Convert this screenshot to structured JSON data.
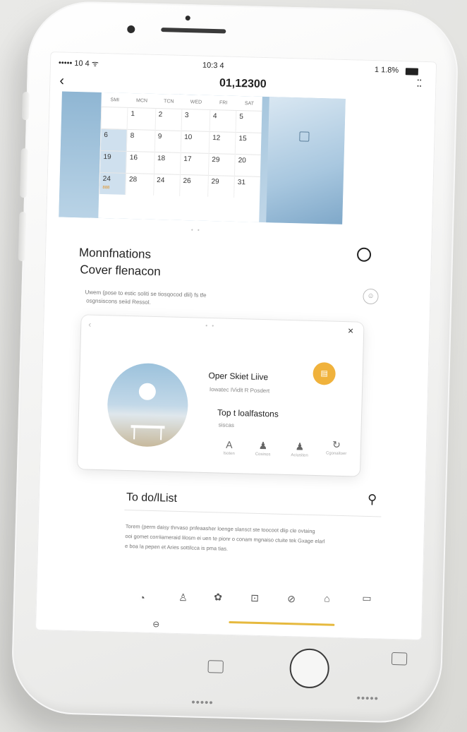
{
  "status": {
    "signal": "••••• 10 4 ᯤ",
    "time": "10:3 4",
    "battery": "1 1.8%"
  },
  "header": {
    "title": "01,12300",
    "back_icon": "chevron-left-icon",
    "more_icon": "grid-dots-icon"
  },
  "calendar": {
    "days": [
      "SMI",
      "MCN",
      "TCN",
      "WED",
      "FRI",
      "SAT"
    ],
    "rows": [
      [
        "",
        "1",
        "2",
        "3",
        "4",
        "5"
      ],
      [
        "6",
        "8",
        "9",
        "10",
        "12",
        "15"
      ],
      [
        "19",
        "16",
        "18",
        "17",
        "29",
        "20"
      ],
      [
        "24",
        "28",
        "24",
        "26",
        "29",
        "31"
      ]
    ],
    "highlight_label": "888",
    "accent": "#cfe0ee"
  },
  "section": {
    "title_line1": "Monnfnations",
    "title_line2": "Cover flenacon",
    "description_line1": "Uwem (pose to estic soliti se tiosqocod dlil) fs tfe",
    "description_line2": "osgnsiscons seiid Ressol."
  },
  "card": {
    "title": "Oper Skiet Liive",
    "subtitle": "Iowatec IVidlt R Posdert",
    "heading2": "Top t loalfastons",
    "sub2": "siscas",
    "badge_accent": "#f0b23c",
    "actions": [
      {
        "icon": "letter-a-icon",
        "label": "Isoten"
      },
      {
        "icon": "person-icon",
        "label": "Cosinos"
      },
      {
        "icon": "person-icon",
        "label": "Aciusiten"
      },
      {
        "icon": "refresh-icon",
        "label": "Cgonaitoer"
      }
    ]
  },
  "todo": {
    "title": "To do/lList",
    "text_line1": "Torem (perm daisy thrvaso pnfeaasher loenge slansct ste toocoot dlip cle ovtaing",
    "text_line2": "ooi gomet corriiameraid lilosm ei uen te pionr o conam mgnaiso ctuite tek Gxage elarl",
    "text_line3": "e boa la pepen et Aries sottilcca is pma tias."
  },
  "tabbar": {
    "icons": [
      "clock-icon",
      "person-icon",
      "flower-icon",
      "camera-icon",
      "link-icon",
      "pot-icon",
      "folder-icon"
    ],
    "accent": "#e6b93e"
  }
}
